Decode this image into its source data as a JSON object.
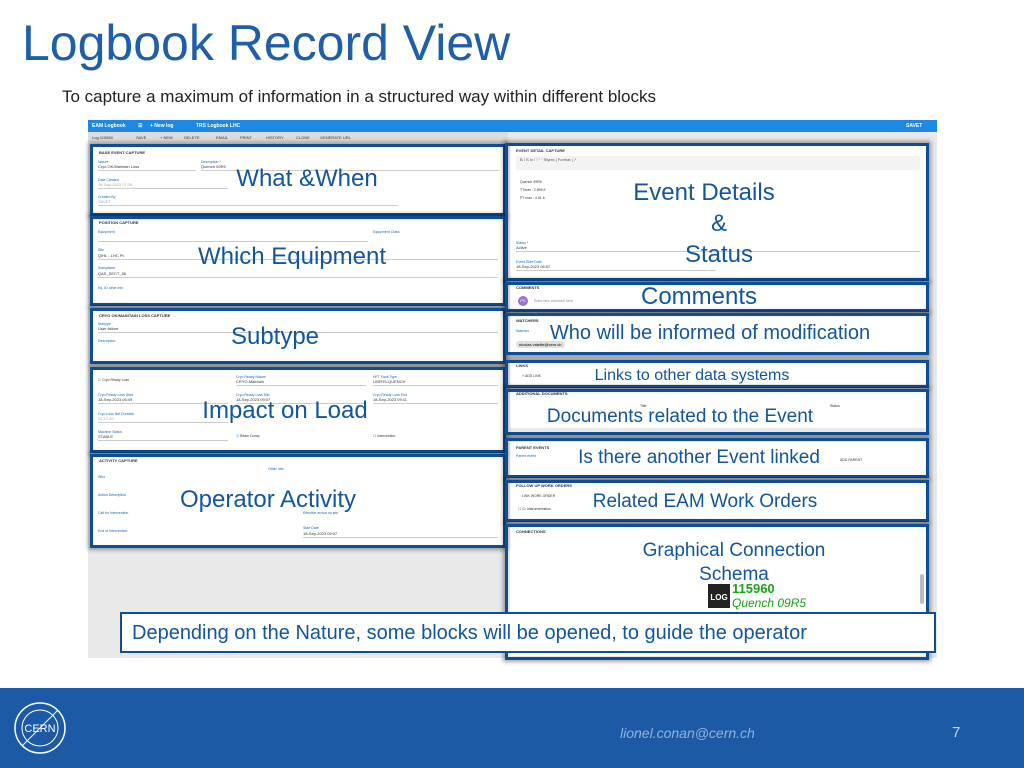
{
  "slide": {
    "title": "Logbook Record View",
    "subtitle": "To capture a maximum of information in a structured way within different blocks",
    "banner": "Depending on the Nature, some blocks will be opened, to guide the operator",
    "email": "lionel.conan@cern.ch",
    "page_number": "7",
    "logo_text": "CERN"
  },
  "app": {
    "name": "EAM Logbook",
    "new_log": "+ New log",
    "logbook": "TRS Logbook LHC",
    "user": "SAVET",
    "toolbar": [
      "Log 115960",
      "SAVE",
      "+ NEW",
      "DELETE",
      "EMAIL",
      "PRINT",
      "HISTORY",
      "CLONE",
      "GENERATE URL"
    ],
    "base": {
      "header": "BASE EVENT CAPTURE",
      "nature_label": "Nature",
      "nature": "Cryo OK/Maintain Loss",
      "description_label": "Description *",
      "description": "Quench 09R5",
      "date_label": "Date Created",
      "date": "18-Sep-2023 07:26",
      "created_label": "Created By",
      "created": "SAVET"
    },
    "position": {
      "header": "POSITION CAPTURE",
      "equipment_label": "Equipment",
      "equipment_class_label": "Equipment Class",
      "site_label": "Site",
      "site": "QIHL - LHC Pt.",
      "subsystem_label": "Subsystem",
      "subsystem": "QAS_SECT_56",
      "key_label": "Eq. ID other info"
    },
    "cryo": {
      "header": "CRYO OK/MAINTAIN LOSS CAPTURE",
      "subtype_label": "Subtype",
      "subtype": "User failure",
      "description_label": "Description"
    },
    "impact": {
      "cryo_ready_loss": "Cryo Ready Loss",
      "status_label": "Cryo Ready Nature",
      "status": "CRYO-Maintain",
      "fault_label": "HFT Fault Type",
      "fault": "USERS-QUENCH",
      "start_label": "Cryo Ready Loss Start",
      "start": "18-Sep-2023 06:49",
      "mid_label": "Cryo Ready Loss Mid",
      "mid": "18-Sep-2023 09:07",
      "end_label": "Cryo Ready Loss End",
      "end": "18-Sep-2023 09:11",
      "duration_label": "Cryo Loss Net Duration",
      "duration": "02:17:40",
      "machine_label": "Machine Status",
      "machine": "STABLE",
      "beam": "Beam Dump",
      "intervention": "Intervention"
    },
    "activity": {
      "header": "ACTIVITY CAPTURE",
      "who": "Who",
      "other": "Other Info",
      "action": "Action Description",
      "call": "Call for Intervention",
      "effective": "Effective arrival on site",
      "end": "End of Intervention",
      "start_label": "Start Date",
      "start": "18-Sep-2023 09:07"
    },
    "detail": {
      "header": "EVENT DETAIL CAPTURE",
      "lines": [
        "Quench 09R5",
        "TTmax : 2.899 K",
        "PT max : 4.01 b"
      ],
      "status_label": "Status *",
      "status": "Active",
      "start_label": "Event Start Date",
      "start": "18-Sep-2023 06:57"
    },
    "comments": {
      "header": "COMMENTS",
      "avatar": "PC",
      "placeholder": "Enter new comment here"
    },
    "watchers": {
      "header": "WATCHERS",
      "label": "Watcher",
      "chip": "nicolas.valette@cern.ch"
    },
    "links": {
      "header": "LINKS",
      "add": "+ ADD LINK"
    },
    "docs": {
      "header": "ADDITIONAL DOCUMENTS",
      "title": "Title",
      "status": "Status"
    },
    "parent": {
      "header": "PARENT EVENTS",
      "label": "Parent event",
      "add": "ADD PARENT"
    },
    "work": {
      "header": "FOLLOW UP WORK ORDERS",
      "link": "LINK WORK ORDER",
      "check": "Cr Instrumentation"
    },
    "connections": {
      "header": "CONNECTIONS",
      "log_id": "115960",
      "log_title": "Quench 09R5",
      "log_badge": "LOG"
    }
  },
  "annotations": {
    "what": "What &When",
    "equipment": "Which Equipment",
    "subtype": "Subtype",
    "impact": "Impact on Load",
    "activity": "Operator Activity",
    "details": "Event Details",
    "amp": "&",
    "status": "Status",
    "comments": "Comments",
    "watchers": "Who will be informed of modification",
    "links": "Links to other data systems",
    "docs": "Documents related to the Event",
    "parent": "Is there another Event linked",
    "work": "Related EAM Work Orders",
    "graph1": "Graphical Connection",
    "graph2": "Schema"
  },
  "colors": {
    "title": "#1f5fa8",
    "annotation": "#1256a0",
    "frame": "#0f4e96",
    "appbar": "#1e88e5",
    "footer": "#1c5aa6"
  }
}
